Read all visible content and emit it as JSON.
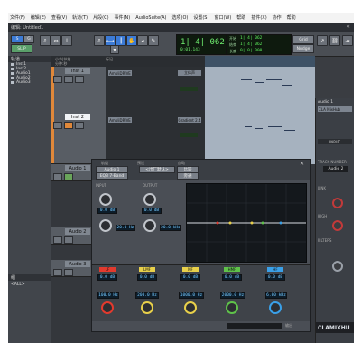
{
  "app": {
    "menu": [
      "文件(F)",
      "编辑(E)",
      "查看(V)",
      "轨道(T)",
      "片段(C)",
      "事件(N)",
      "AudioSuite(A)",
      "选项(O)",
      "设置(S)",
      "窗口(W)",
      "帮助",
      "插件(X)",
      "协作",
      "帮助"
    ],
    "window_title": "编辑: Untitled1"
  },
  "toolbar": {
    "mode_label": "SLIP",
    "counter_main": "1| 4| 062",
    "counter_sub": "0:01.143",
    "counter_labels": [
      "开始",
      "结束",
      "长度"
    ],
    "counter_values": [
      "1| 4| 062",
      "1| 4| 062",
      "0| 0| 000"
    ],
    "grid_label": "Grid",
    "nudge_label": "Nudge"
  },
  "left_panel": {
    "header": "轨道",
    "tracks": [
      "Inst1",
      "Inst2",
      "Audio1",
      "Audio2",
      "Audio3"
    ],
    "groups_header": "组",
    "groups": [
      "<ALL>"
    ]
  },
  "ruler": {
    "labels": [
      "小节|节拍",
      "分钟:秒",
      "标记"
    ]
  },
  "tracks": [
    {
      "name": "Inst 1",
      "selected": false,
      "color": "#e0883a"
    },
    {
      "name": "Inst 2",
      "selected": true,
      "color": "#e0883a"
    },
    {
      "name": "Audio 1",
      "selected": false,
      "color": "#6d7a8a"
    },
    {
      "name": "Audio 2",
      "selected": false,
      "color": "#6d7a8a"
    },
    {
      "name": "Audio 3",
      "selected": false,
      "color": "#6d7a8a"
    }
  ],
  "insert_slots": [
    {
      "label": "AmpliDRIVE",
      "out": "立体声"
    },
    {
      "label": "AmpliDRIVE",
      "out": "Gradient 2.4"
    }
  ],
  "plugin": {
    "track": "Audio 1",
    "preset": "<出厂默认>",
    "plugin_name": "EQ3 7-Band",
    "compare": "比较",
    "auto": "自动",
    "bypass": "旁通",
    "input_label": "INPUT",
    "output_label": "OUTPUT",
    "filters": [
      {
        "type": "HPF",
        "freq": "20.0 Hz"
      },
      {
        "type": "LPF",
        "freq": "20.0 kHz"
      }
    ],
    "input_value": "0.0 dB",
    "bands": [
      {
        "label": "LF",
        "gain": "0.0 dB",
        "freq": "100.0 Hz",
        "color": "#e23a2e"
      },
      {
        "label": "LMF",
        "gain": "0.0 dB",
        "freq": "200.0 Hz",
        "q": "1.00",
        "color": "#e8d04a"
      },
      {
        "label": "MF",
        "gain": "0.0 dB",
        "freq": "1000.0 Hz",
        "q": "1.00",
        "color": "#e8d04a"
      },
      {
        "label": "HMF",
        "gain": "0.0 dB",
        "freq": "2000.0 Hz",
        "q": "1.00",
        "color": "#5fc24a"
      },
      {
        "label": "HF",
        "gain": "0.0 dB",
        "freq": "6.00 kHz",
        "color": "#3aa0e8"
      }
    ],
    "footer": "输出"
  },
  "right_panel": {
    "title": "Audio 1",
    "plugin": "CLA MixHub",
    "insert_label": "INPUT",
    "track_number": "Audio 2",
    "sections": [
      "TRACK NUMBER",
      "LINK",
      "HIGH",
      "LOW",
      "FILTERS"
    ],
    "brand": "CLAMIXHU"
  }
}
